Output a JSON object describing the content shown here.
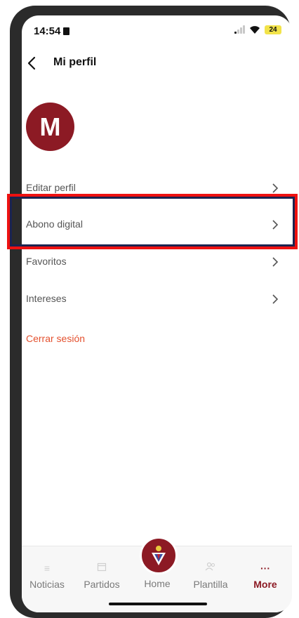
{
  "status": {
    "time": "14:54",
    "battery": "24"
  },
  "header": {
    "title": "Mi perfil"
  },
  "profile": {
    "avatar_letter": "M"
  },
  "menu": [
    {
      "label": "Editar perfil"
    },
    {
      "label": "Abono digital"
    },
    {
      "label": "Favoritos"
    },
    {
      "label": "Intereses"
    }
  ],
  "logout": {
    "label": "Cerrar sesión"
  },
  "tabs": [
    {
      "label": "Noticias",
      "icon": "list-icon"
    },
    {
      "label": "Partidos",
      "icon": "calendar-icon"
    },
    {
      "label": "Home",
      "icon": "club-crest-icon"
    },
    {
      "label": "Plantilla",
      "icon": "people-icon"
    },
    {
      "label": "More",
      "icon": "ellipsis-icon"
    }
  ],
  "colors": {
    "brand": "#8c1a24",
    "logout": "#e4512f",
    "highlight": "#ee1111"
  }
}
